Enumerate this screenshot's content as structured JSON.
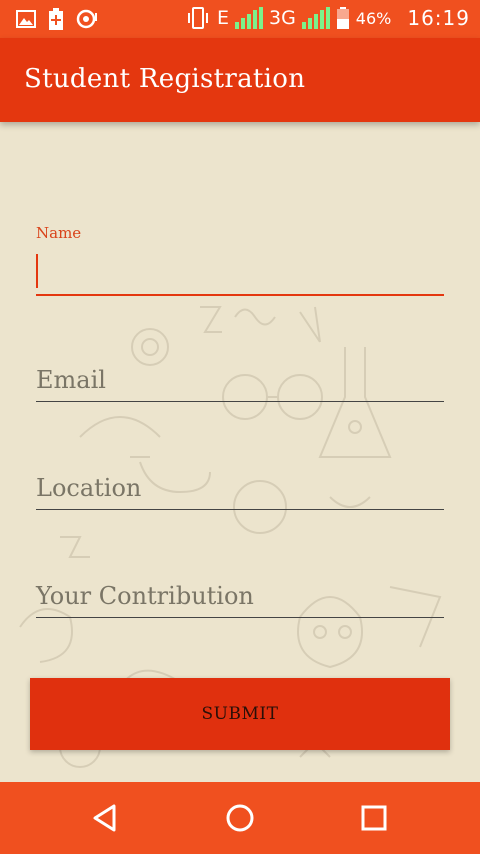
{
  "status_bar": {
    "network_e": "E",
    "network_3g": "3G",
    "battery_pct": "46%",
    "time": "16:19",
    "icons": [
      "image-icon",
      "battery-saver-icon",
      "fuel-icon",
      "vibrate-icon",
      "signal-icon",
      "signal-icon",
      "battery-icon"
    ]
  },
  "app_bar": {
    "title": "Student Registration"
  },
  "form": {
    "name_label": "Name",
    "name_value": "",
    "email_placeholder": "Email",
    "location_placeholder": "Location",
    "contribution_placeholder": "Your Contribution",
    "submit_label": "SUBMIT"
  },
  "nav": {
    "icons": [
      "back-icon",
      "home-icon",
      "recents-icon"
    ]
  },
  "colors": {
    "primary": "#e4370f",
    "status": "#f0501f",
    "background": "#ece4cd",
    "signal": "#7cf28a"
  }
}
